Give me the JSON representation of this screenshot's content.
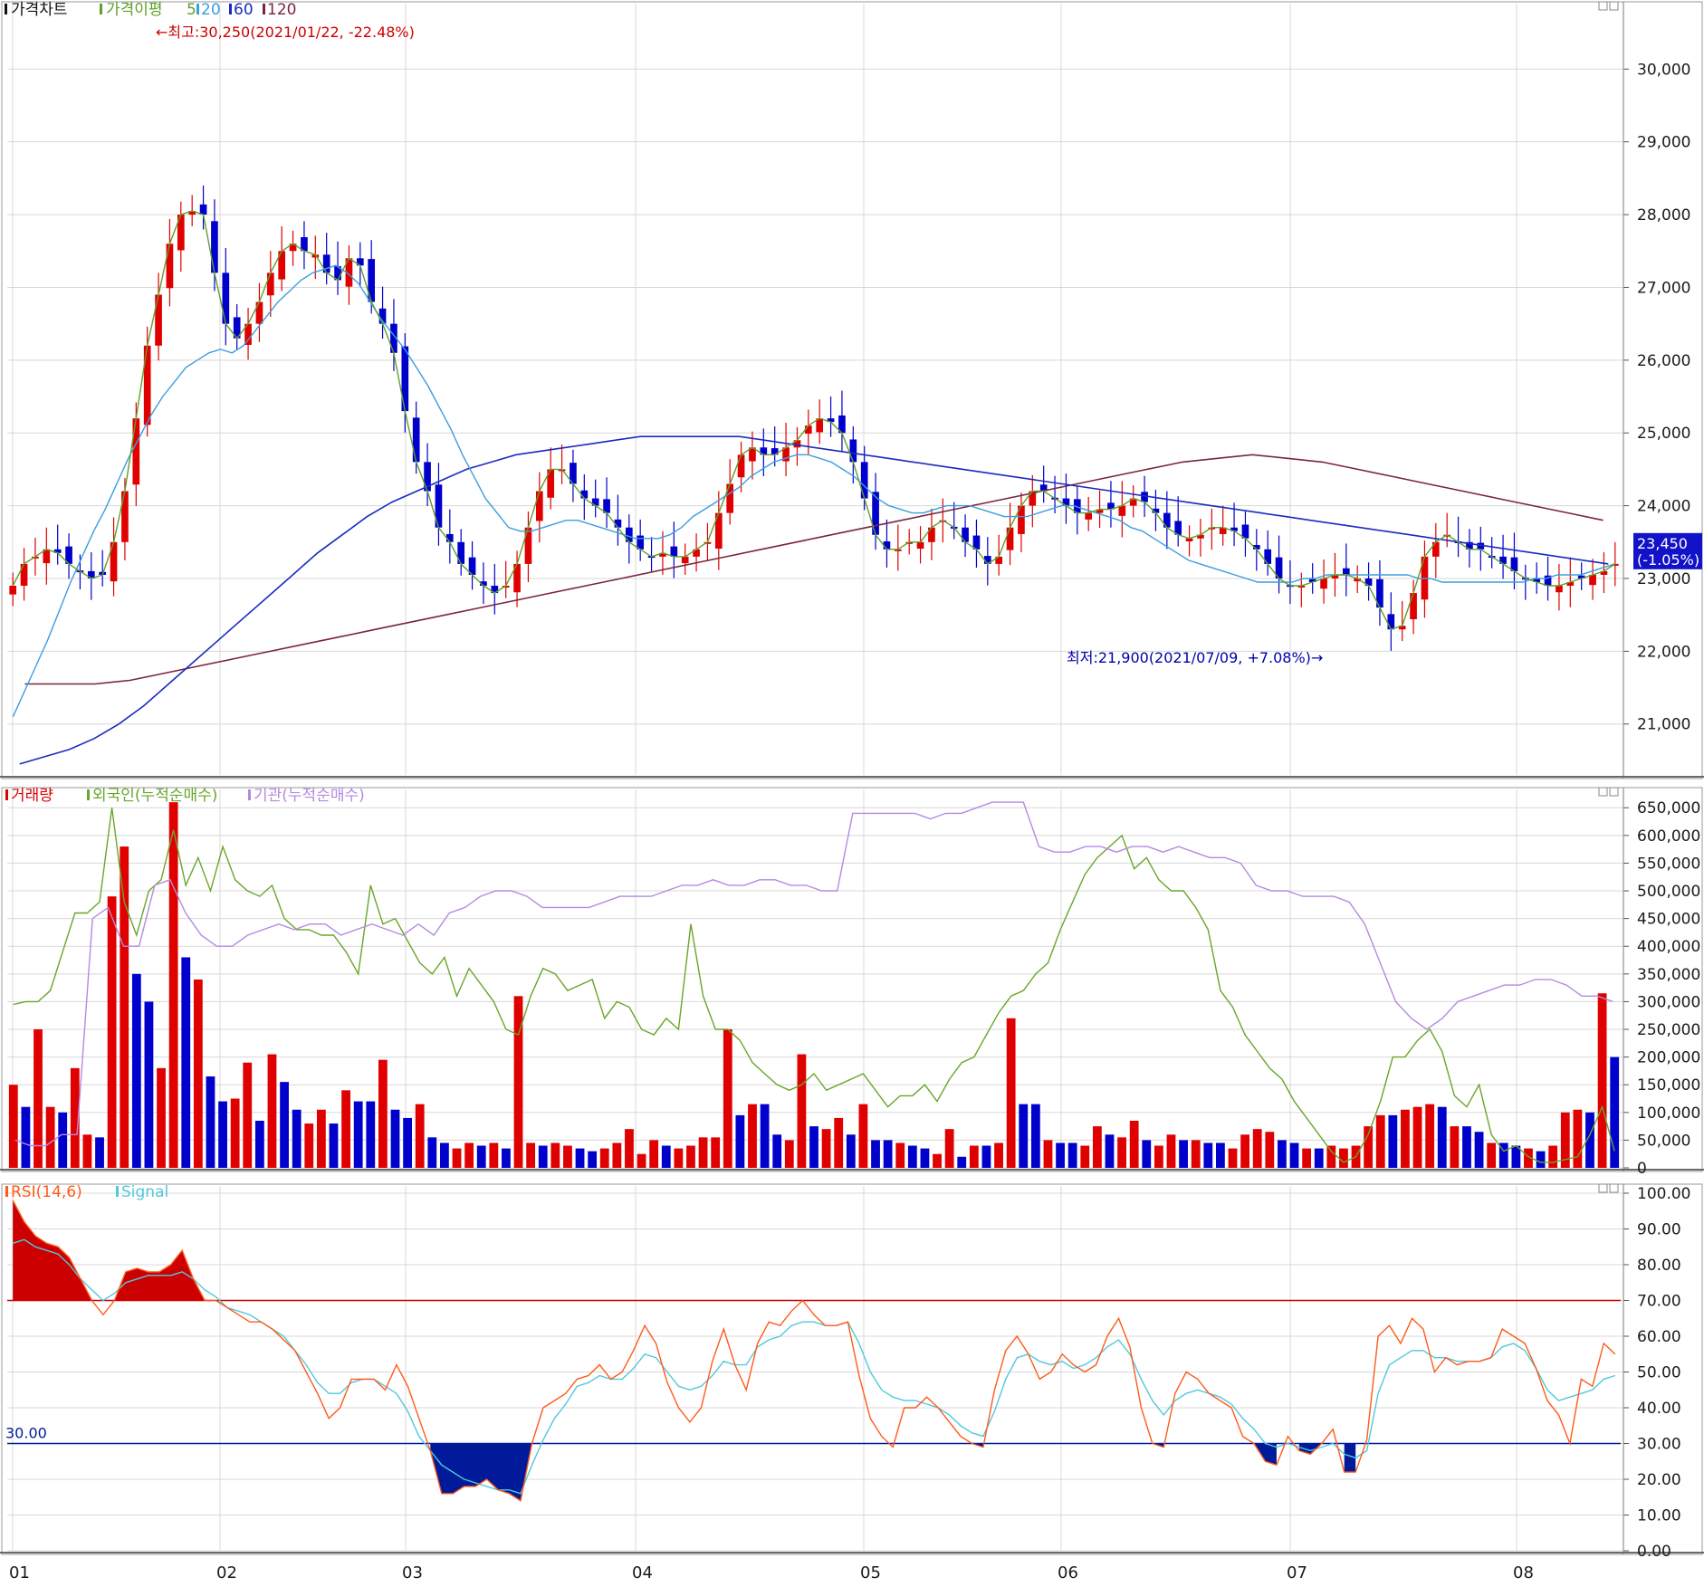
{
  "colors": {
    "up": "#e00000",
    "down": "#0000cc",
    "ma5": "#5fa02a",
    "ma20": "#3a9ee0",
    "ma60": "#1a2bbf",
    "ma120": "#7a2540",
    "foreign": "#6aa52a",
    "institution": "#b48ae0",
    "rsi": "#ff5a1a",
    "signal": "#52c8dc",
    "overbought": "#cc0000",
    "oversold": "#001a99",
    "grid": "#d8d8d8",
    "text": "#1a1a1a",
    "last_price_bg": "#1212c8"
  },
  "chart_data": [
    {
      "type": "candlestick",
      "panel_title": "가격차트",
      "legend": {
        "label": "가격이평",
        "items": [
          "5",
          "20",
          "60",
          "120"
        ]
      },
      "ylim": [
        20300,
        30800
      ],
      "yticks": [
        "30,000",
        "29,000",
        "28,000",
        "27,000",
        "26,000",
        "25,000",
        "24,000",
        "23,000",
        "22,000",
        "21,000"
      ],
      "ytick_values": [
        30000,
        29000,
        28000,
        27000,
        26000,
        25000,
        24000,
        23000,
        22000,
        21000
      ],
      "x_month_labels": [
        "01",
        "02",
        "03",
        "04",
        "05",
        "06",
        "07",
        "08"
      ],
      "annotations": {
        "high": "←최고:30,250(2021/01/22, -22.48%)",
        "low": "최저:21,900(2021/07/09, +7.08%)→"
      },
      "last_price": {
        "value": "23,450",
        "change": "(-1.05%)"
      },
      "series_ma5": [
        22900,
        23200,
        23300,
        23400,
        23350,
        23200,
        23100,
        23000,
        23050,
        23500,
        24200,
        25200,
        26200,
        26900,
        27600,
        28000,
        28050,
        28000,
        27200,
        26500,
        26300,
        26500,
        26800,
        27200,
        27500,
        27600,
        27500,
        27450,
        27200,
        27100,
        27400,
        27300,
        26800,
        26500,
        26100,
        25300,
        24600,
        24200,
        23700,
        23500,
        23200,
        23050,
        22900,
        22800,
        22900,
        23200,
        23700,
        24200,
        24500,
        24500,
        24300,
        24100,
        24000,
        23900,
        23700,
        23500,
        23400,
        23300,
        23350,
        23300,
        23300,
        23400,
        23500,
        23900,
        24300,
        24700,
        24800,
        24700,
        24700,
        24800,
        24900,
        25100,
        25200,
        25150,
        25000,
        24600,
        24100,
        23600,
        23400,
        23400,
        23500,
        23500,
        23700,
        23800,
        23700,
        23500,
        23400,
        23200,
        23300,
        23700,
        24000,
        24200,
        24200,
        24100,
        24000,
        23900,
        23900,
        23950,
        23950,
        24000,
        24100,
        24050,
        23900,
        23700,
        23600,
        23550,
        23600,
        23700,
        23700,
        23650,
        23550,
        23400,
        23200,
        23000,
        22900,
        22900,
        22950,
        23000,
        23050,
        23050,
        23000,
        22900,
        22600,
        22300,
        22350,
        22800,
        23300,
        23500,
        23600,
        23500,
        23400,
        23400,
        23300,
        23200,
        23100,
        23000,
        22950,
        22900,
        22900,
        22950,
        23000,
        23050,
        23100,
        23200
      ],
      "series_ma20": [
        21100,
        21450,
        21800,
        22150,
        22550,
        22950,
        23300,
        23650,
        23950,
        24300,
        24650,
        24950,
        25250,
        25500,
        25700,
        25900,
        26000,
        26100,
        26150,
        26100,
        26200,
        26400,
        26600,
        26800,
        26950,
        27100,
        27200,
        27250,
        27300,
        27200,
        27050,
        26800,
        26550,
        26350,
        26150,
        25900,
        25650,
        25350,
        25050,
        24700,
        24400,
        24100,
        23900,
        23700,
        23650,
        23650,
        23700,
        23750,
        23800,
        23800,
        23750,
        23700,
        23650,
        23600,
        23550,
        23550,
        23550,
        23600,
        23700,
        23850,
        23950,
        24050,
        24150,
        24250,
        24400,
        24500,
        24600,
        24650,
        24700,
        24700,
        24650,
        24600,
        24500,
        24400,
        24250,
        24100,
        24000,
        23950,
        23900,
        23900,
        23950,
        24000,
        24000,
        24000,
        23950,
        23900,
        23850,
        23850,
        23850,
        23900,
        23950,
        24000,
        24000,
        23950,
        23900,
        23850,
        23800,
        23700,
        23650,
        23550,
        23450,
        23350,
        23250,
        23200,
        23150,
        23100,
        23050,
        23000,
        22950,
        22950,
        22950,
        22950,
        23000,
        23000,
        23050,
        23050,
        23050,
        23050,
        23050,
        23050,
        23050,
        23050,
        23000,
        23000,
        22950,
        22950,
        22950,
        22950,
        22950,
        22950,
        22950,
        22950,
        23000,
        23000,
        23050,
        23050,
        23050,
        23100,
        23150,
        23200
      ],
      "series_ma60": [
        20450,
        20550,
        20650,
        20800,
        21000,
        21250,
        21550,
        21850,
        22150,
        22450,
        22750,
        23050,
        23350,
        23600,
        23850,
        24050,
        24200,
        24350,
        24500,
        24600,
        24700,
        24750,
        24800,
        24850,
        24900,
        24950,
        24950,
        24950,
        24950,
        24950,
        24900,
        24850,
        24800,
        24750,
        24700,
        24650,
        24600,
        24550,
        24500,
        24450,
        24400,
        24350,
        24300,
        24250,
        24200,
        24150,
        24100,
        24050,
        24000,
        23950,
        23900,
        23850,
        23800,
        23750,
        23700,
        23650,
        23600,
        23550,
        23500,
        23450,
        23400,
        23350,
        23300,
        23250,
        23200
      ],
      "series_ma120": [
        21550,
        21550,
        21550,
        21600,
        21700,
        21800,
        21900,
        22000,
        22100,
        22200,
        22300,
        22400,
        22500,
        22600,
        22700,
        22800,
        22900,
        23000,
        23100,
        23200,
        23300,
        23400,
        23500,
        23600,
        23700,
        23800,
        23900,
        24000,
        24100,
        24200,
        24300,
        24400,
        24500,
        24600,
        24650,
        24700,
        24650,
        24600,
        24500,
        24400,
        24300,
        24200,
        24100,
        24000,
        23900,
        23800
      ]
    },
    {
      "type": "bar",
      "panel_title": "거래량",
      "legend_items": [
        "거래량",
        "외국인(누적순매수)",
        "기관(누적순매수)"
      ],
      "ylim": [
        0,
        670000
      ],
      "yticks": [
        "650,000",
        "600,000",
        "550,000",
        "500,000",
        "450,000",
        "400,000",
        "350,000",
        "300,000",
        "250,000",
        "200,000",
        "150,000",
        "100,000",
        "50,000",
        "0"
      ],
      "ytick_values": [
        650000,
        600000,
        550000,
        500000,
        450000,
        400000,
        350000,
        300000,
        250000,
        200000,
        150000,
        100000,
        50000,
        0
      ],
      "volume": [
        150000,
        110000,
        250000,
        110000,
        100000,
        180000,
        60000,
        55000,
        490000,
        580000,
        350000,
        300000,
        180000,
        660000,
        380000,
        340000,
        165000,
        120000,
        125000,
        190000,
        85000,
        205000,
        155000,
        105000,
        80000,
        105000,
        80000,
        140000,
        120000,
        120000,
        195000,
        105000,
        90000,
        115000,
        55000,
        45000,
        35000,
        45000,
        40000,
        45000,
        35000,
        310000,
        45000,
        40000,
        45000,
        40000,
        35000,
        30000,
        35000,
        45000,
        70000,
        25000,
        50000,
        40000,
        35000,
        40000,
        55000,
        55000,
        250000,
        95000,
        115000,
        115000,
        60000,
        50000,
        205000,
        75000,
        70000,
        90000,
        60000,
        115000,
        50000,
        50000,
        45000,
        40000,
        35000,
        25000,
        70000,
        20000,
        40000,
        40000,
        45000,
        270000,
        115000,
        115000,
        50000,
        45000,
        45000,
        40000,
        75000,
        60000,
        55000,
        85000,
        50000,
        40000,
        60000,
        50000,
        50000,
        45000,
        45000,
        35000,
        60000,
        70000,
        65000,
        50000,
        45000,
        35000,
        35000,
        40000,
        35000,
        40000,
        75000,
        95000,
        95000,
        105000,
        110000,
        115000,
        110000,
        75000,
        75000,
        65000,
        45000,
        45000,
        40000,
        35000,
        30000,
        40000,
        100000,
        105000,
        100000,
        315000,
        200000
      ],
      "foreign": [
        295000,
        300000,
        300000,
        320000,
        390000,
        460000,
        460000,
        480000,
        650000,
        480000,
        420000,
        500000,
        520000,
        610000,
        510000,
        560000,
        500000,
        580000,
        520000,
        500000,
        490000,
        510000,
        450000,
        430000,
        430000,
        420000,
        420000,
        390000,
        350000,
        510000,
        440000,
        450000,
        410000,
        370000,
        350000,
        380000,
        310000,
        360000,
        330000,
        300000,
        250000,
        240000,
        310000,
        360000,
        350000,
        320000,
        330000,
        340000,
        270000,
        300000,
        290000,
        250000,
        240000,
        270000,
        250000,
        440000,
        310000,
        250000,
        250000,
        230000,
        190000,
        170000,
        150000,
        140000,
        150000,
        170000,
        140000,
        150000,
        160000,
        170000,
        140000,
        110000,
        130000,
        130000,
        150000,
        120000,
        160000,
        190000,
        200000,
        240000,
        280000,
        310000,
        320000,
        350000,
        370000,
        430000,
        480000,
        530000,
        560000,
        580000,
        600000,
        540000,
        560000,
        520000,
        500000,
        500000,
        470000,
        430000,
        320000,
        290000,
        240000,
        210000,
        180000,
        160000,
        120000,
        90000,
        60000,
        30000,
        10000,
        20000,
        60000,
        120000,
        200000,
        200000,
        230000,
        250000,
        210000,
        130000,
        110000,
        150000,
        60000,
        30000,
        40000,
        20000,
        10000,
        10000,
        15000,
        20000,
        60000,
        110000,
        30000
      ],
      "institution": [
        50000,
        40000,
        40000,
        60000,
        60000,
        450000,
        470000,
        400000,
        400000,
        510000,
        520000,
        460000,
        420000,
        400000,
        400000,
        420000,
        430000,
        440000,
        430000,
        440000,
        440000,
        420000,
        430000,
        440000,
        430000,
        420000,
        440000,
        420000,
        460000,
        470000,
        490000,
        500000,
        500000,
        490000,
        470000,
        470000,
        470000,
        470000,
        480000,
        490000,
        490000,
        490000,
        500000,
        510000,
        510000,
        520000,
        510000,
        510000,
        520000,
        520000,
        510000,
        510000,
        500000,
        500000,
        640000,
        640000,
        640000,
        640000,
        640000,
        630000,
        640000,
        640000,
        650000,
        660000,
        660000,
        660000,
        580000,
        570000,
        570000,
        580000,
        580000,
        570000,
        580000,
        580000,
        570000,
        580000,
        570000,
        560000,
        560000,
        550000,
        510000,
        500000,
        500000,
        490000,
        490000,
        490000,
        480000,
        440000,
        370000,
        300000,
        270000,
        250000,
        270000,
        300000,
        310000,
        320000,
        330000,
        330000,
        340000,
        340000,
        330000,
        310000,
        310000,
        300000
      ],
      "last_volume": 200000
    },
    {
      "type": "line",
      "panel_title": "RSI(14,6)",
      "legend_items": [
        "RSI(14,6)",
        "Signal"
      ],
      "ylim": [
        0,
        100
      ],
      "yticks": [
        "100.00",
        "90.00",
        "80.00",
        "70.00",
        "60.00",
        "50.00",
        "40.00",
        "30.00",
        "20.00",
        "10.00",
        "0.00"
      ],
      "ytick_values": [
        100,
        90,
        80,
        70,
        60,
        50,
        40,
        30,
        20,
        10,
        0
      ],
      "upper_band": 70,
      "lower_band": 30,
      "lower_band_label": "30.00",
      "rsi": [
        98,
        92,
        88,
        86,
        85,
        82,
        76,
        70,
        66,
        70,
        78,
        79,
        78,
        78,
        80,
        84,
        76,
        70,
        70,
        68,
        66,
        64,
        64,
        62,
        59,
        56,
        50,
        44,
        37,
        40,
        48,
        48,
        48,
        45,
        52,
        46,
        37,
        28,
        16,
        16,
        18,
        18,
        20,
        17,
        16,
        14,
        30,
        40,
        42,
        44,
        48,
        49,
        52,
        48,
        50,
        56,
        63,
        58,
        47,
        40,
        36,
        40,
        53,
        62,
        52,
        45,
        58,
        64,
        63,
        67,
        70,
        66,
        63,
        63,
        64,
        49,
        37,
        32,
        29,
        40,
        40,
        43,
        40,
        36,
        32,
        30,
        29,
        45,
        56,
        60,
        55,
        48,
        50,
        55,
        52,
        50,
        52,
        60,
        65,
        57,
        40,
        30,
        29,
        44,
        50,
        48,
        44,
        42,
        40,
        32,
        30,
        25,
        24,
        32,
        28,
        27,
        30,
        34,
        22,
        22,
        31,
        60,
        63,
        58,
        65,
        62,
        50,
        54,
        52,
        53,
        53,
        54,
        62,
        60,
        58,
        51,
        42,
        38,
        30,
        48,
        46,
        58,
        55
      ],
      "signal": [
        86,
        87,
        85,
        84,
        83,
        80,
        76,
        73,
        70,
        72,
        75,
        76,
        77,
        77,
        77,
        78,
        76,
        73,
        71,
        68,
        67,
        66,
        64,
        62,
        60,
        56,
        52,
        47,
        44,
        44,
        47,
        48,
        48,
        46,
        44,
        39,
        32,
        28,
        24,
        22,
        20,
        19,
        18,
        17,
        17,
        16,
        24,
        31,
        37,
        41,
        46,
        47,
        49,
        48,
        48,
        51,
        55,
        54,
        50,
        46,
        45,
        46,
        49,
        53,
        52,
        52,
        57,
        59,
        60,
        63,
        64,
        64,
        63,
        63,
        64,
        58,
        50,
        45,
        43,
        42,
        42,
        41,
        40,
        38,
        35,
        33,
        32,
        39,
        48,
        54,
        55,
        53,
        52,
        53,
        51,
        52,
        54,
        57,
        59,
        55,
        48,
        42,
        38,
        42,
        44,
        45,
        44,
        43,
        41,
        37,
        34,
        30,
        29,
        30,
        29,
        28,
        29,
        30,
        27,
        26,
        28,
        44,
        52,
        54,
        56,
        56,
        54,
        54,
        53,
        53,
        53,
        54,
        57,
        58,
        56,
        51,
        45,
        42,
        43,
        44,
        45,
        48,
        49
      ]
    }
  ]
}
